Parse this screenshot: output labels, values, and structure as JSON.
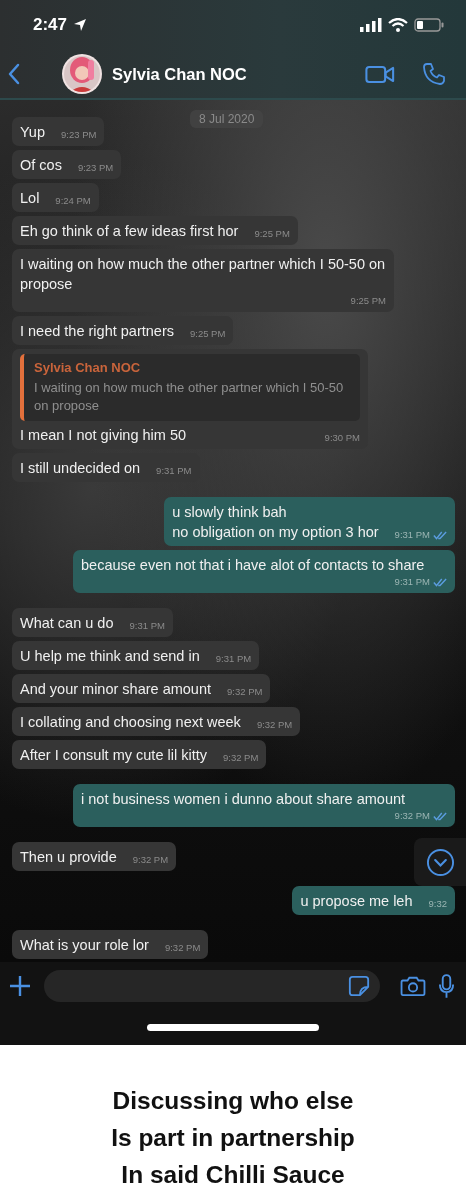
{
  "status_bar": {
    "time": "2:47"
  },
  "header": {
    "contact_name": "Sylvia Chan NOC"
  },
  "date_chip": "8 Jul 2020",
  "messages": [
    {
      "kind": "in",
      "text": "Yup",
      "time": "9:23 PM"
    },
    {
      "kind": "in",
      "text": "Of cos",
      "time": "9:23 PM"
    },
    {
      "kind": "in",
      "text": "Lol",
      "time": "9:24 PM"
    },
    {
      "kind": "in",
      "text": "Eh go think of a few ideas first hor",
      "time": "9:25 PM"
    },
    {
      "kind": "in",
      "text": "I waiting on how much the other partner which I 50-50 on propose",
      "time": "9:25 PM"
    },
    {
      "kind": "in",
      "text": "I need the right partners",
      "time": "9:25 PM"
    },
    {
      "kind": "in",
      "text": "I mean I not giving him 50",
      "time": "9:30 PM",
      "reply_to": {
        "author": "Sylvia Chan NOC",
        "text": "I waiting on how much the other partner which I 50-50 on propose"
      }
    },
    {
      "kind": "in",
      "text": "I still undecided on",
      "time": "9:31 PM"
    },
    {
      "kind": "out",
      "text": "u slowly think bah\nno obligation on my option 3 hor",
      "time": "9:31 PM",
      "read": true
    },
    {
      "kind": "out",
      "text": "because even not that i have alot of contacts to share",
      "time": "9:31 PM",
      "read": true
    },
    {
      "kind": "in",
      "text": "What can u do",
      "time": "9:31 PM"
    },
    {
      "kind": "in",
      "text": "U help me think and send in",
      "time": "9:31 PM"
    },
    {
      "kind": "in",
      "text": "And your minor share amount",
      "time": "9:32 PM"
    },
    {
      "kind": "in",
      "text": "I collating and choosing next week",
      "time": "9:32 PM"
    },
    {
      "kind": "in",
      "text": "After I consult my cute lil kitty",
      "time": "9:32 PM"
    },
    {
      "kind": "out",
      "text": "i not business women i dunno about share amount",
      "time": "9:32 PM",
      "read": true
    },
    {
      "kind": "in",
      "text": "Then u provide",
      "time": "9:32 PM"
    },
    {
      "kind": "out",
      "text": "u propose me leh",
      "time": "9:32",
      "read": false
    },
    {
      "kind": "in",
      "text": "What is your role lor",
      "time": "9:32 PM"
    }
  ],
  "caption": "Discussing who else\nIs part in partnership\nIn said Chilli Sauce"
}
